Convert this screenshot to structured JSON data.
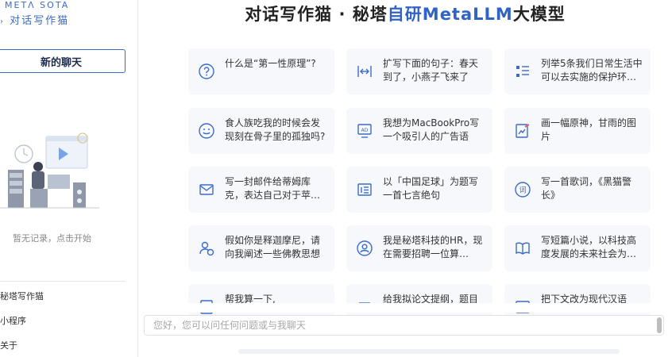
{
  "sidebar": {
    "logo_top": "METΛ SOTA",
    "logo_bottom": "对话写作猫",
    "new_chat_label": "新的聊天",
    "empty_text": "暂无记录，点击开始",
    "links": [
      "秘塔写作猫",
      "小程序",
      "关于"
    ]
  },
  "header": {
    "title_prefix": "对话写作猫 · 秘塔",
    "title_accent": "自研MetaLLM",
    "title_suffix": "大模型"
  },
  "prompts": [
    {
      "icon": "question-icon",
      "text": "什么是“第一性原理”?"
    },
    {
      "icon": "expand-icon",
      "text": "扩写下面的句子：春天到了，小燕子飞来了"
    },
    {
      "icon": "list-icon",
      "text": "列举5条我们日常生活中可以去实施的保护环…"
    },
    {
      "icon": "smile-icon",
      "text": "食人族吃我的时候会发现刻在骨子里的孤独吗?"
    },
    {
      "icon": "ad-screen-icon",
      "text": "我想为MacBookPro写一个吸引人的广告语"
    },
    {
      "icon": "paint-icon",
      "text": "画一幅原神，甘雨的图片"
    },
    {
      "icon": "mail-icon",
      "text": "写一封邮件给蒂姆库克，表达自己对于苹…"
    },
    {
      "icon": "poem-icon",
      "text": "以「中国足球」为题写一首七言绝句"
    },
    {
      "icon": "lyrics-icon",
      "text": "写一首歌词，《黑猫警长》"
    },
    {
      "icon": "user-chat-icon",
      "text": "假如你是释迦摩尼，请向我阐述一些佛教思想"
    },
    {
      "icon": "hr-icon",
      "text": "我是秘塔科技的HR，现在需要招聘一位算…"
    },
    {
      "icon": "book-icon",
      "text": "写短篇小说，以科技高度发展的未来社会为…"
    },
    {
      "icon": "calculator-icon",
      "text": "帮我算一下,"
    },
    {
      "icon": "outline-icon",
      "text": "给我拟论文提纲，题目"
    },
    {
      "icon": "translate-icon",
      "text": "把下文改为现代汉语"
    }
  ],
  "input": {
    "placeholder": "您好，您可以问任何问题或与我聊天",
    "value": ""
  },
  "colors": {
    "accent": "#2f63c7",
    "card_bg": "#f6f8fb",
    "icon": "#3a6bc9"
  }
}
